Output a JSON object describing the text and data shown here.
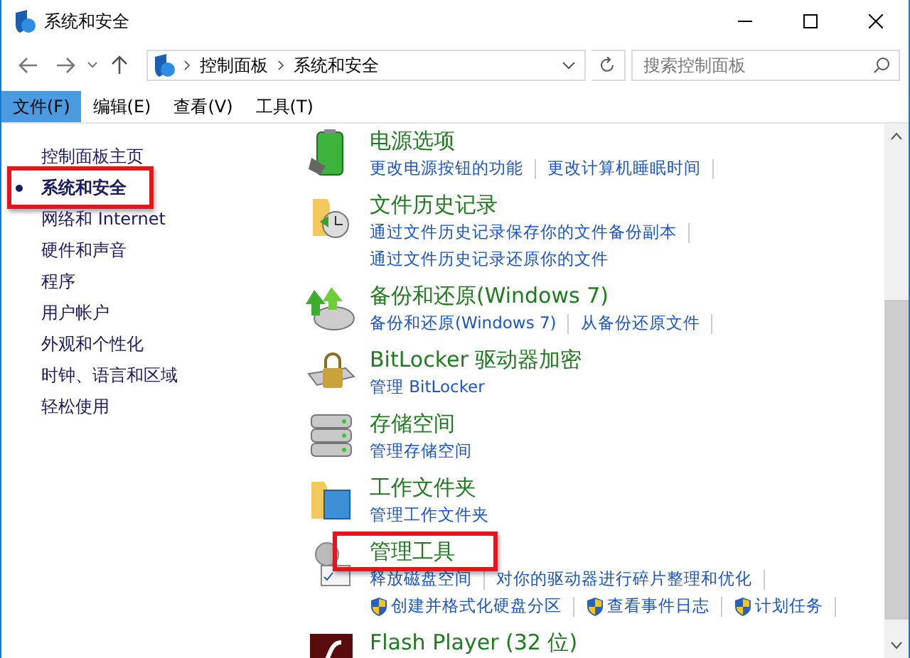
{
  "window": {
    "title": "系统和安全"
  },
  "address": {
    "crumbs": [
      "控制面板",
      "系统和安全"
    ]
  },
  "search": {
    "placeholder": "搜索控制面板"
  },
  "menu": [
    {
      "label": "文件(F)",
      "selected": true
    },
    {
      "label": "编辑(E)",
      "selected": false
    },
    {
      "label": "查看(V)",
      "selected": false
    },
    {
      "label": "工具(T)",
      "selected": false
    }
  ],
  "sidebar": {
    "items": [
      {
        "label": "控制面板主页",
        "selected": false,
        "highlighted": false
      },
      {
        "label": "系统和安全",
        "selected": true,
        "highlighted": true
      },
      {
        "label": "网络和 Internet",
        "selected": false,
        "highlighted": false
      },
      {
        "label": "硬件和声音",
        "selected": false,
        "highlighted": false
      },
      {
        "label": "程序",
        "selected": false,
        "highlighted": false
      },
      {
        "label": "用户帐户",
        "selected": false,
        "highlighted": false
      },
      {
        "label": "外观和个性化",
        "selected": false,
        "highlighted": false
      },
      {
        "label": "时钟、语言和区域",
        "selected": false,
        "highlighted": false
      },
      {
        "label": "轻松使用",
        "selected": false,
        "highlighted": false
      }
    ]
  },
  "sections": [
    {
      "title": "电源选项",
      "highlighted": false,
      "links": [
        [
          {
            "text": "更改电源按钮的功能",
            "shield": false
          },
          {
            "text": "更改计算机睡眠时间",
            "shield": false
          }
        ]
      ]
    },
    {
      "title": "文件历史记录",
      "highlighted": false,
      "links": [
        [
          {
            "text": "通过文件历史记录保存你的文件备份副本",
            "shield": false
          }
        ],
        [
          {
            "text": "通过文件历史记录还原你的文件",
            "shield": false
          }
        ]
      ]
    },
    {
      "title": "备份和还原(Windows 7)",
      "highlighted": false,
      "links": [
        [
          {
            "text": "备份和还原(Windows 7)",
            "shield": false
          },
          {
            "text": "从备份还原文件",
            "shield": false
          }
        ]
      ]
    },
    {
      "title": "BitLocker 驱动器加密",
      "highlighted": false,
      "links": [
        [
          {
            "text": "管理 BitLocker",
            "shield": false
          }
        ]
      ]
    },
    {
      "title": "存储空间",
      "highlighted": false,
      "links": [
        [
          {
            "text": "管理存储空间",
            "shield": false
          }
        ]
      ]
    },
    {
      "title": "工作文件夹",
      "highlighted": false,
      "links": [
        [
          {
            "text": "管理工作文件夹",
            "shield": false
          }
        ]
      ]
    },
    {
      "title": "管理工具",
      "highlighted": true,
      "links": [
        [
          {
            "text": "释放磁盘空间",
            "shield": false
          },
          {
            "text": "对你的驱动器进行碎片整理和优化",
            "shield": false
          }
        ],
        [
          {
            "text": "创建并格式化硬盘分区",
            "shield": true
          },
          {
            "text": "查看事件日志",
            "shield": true
          },
          {
            "text": "计划任务",
            "shield": true
          }
        ]
      ]
    },
    {
      "title": "Flash Player (32 位)",
      "highlighted": false
    }
  ]
}
